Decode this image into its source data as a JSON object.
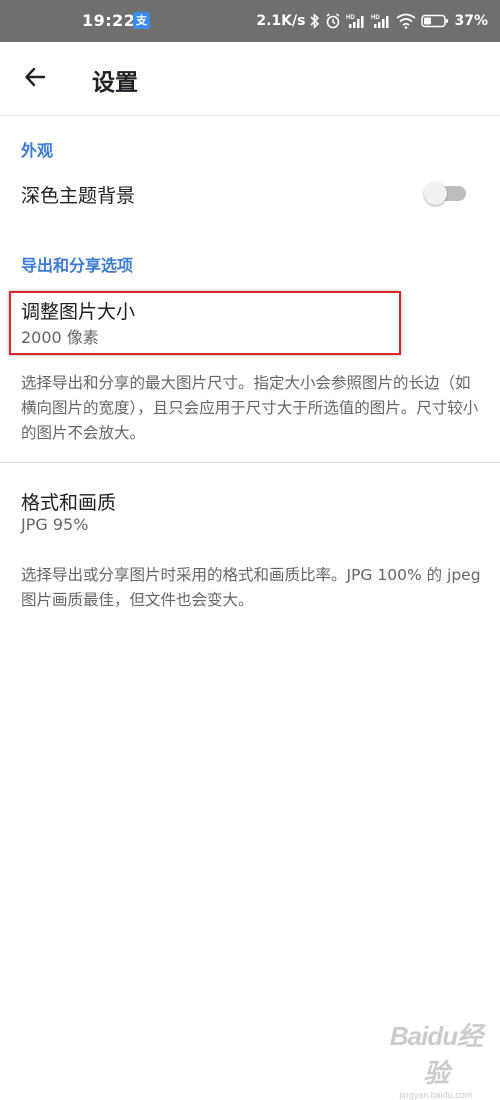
{
  "status_bar": {
    "time": "19:22",
    "app_icon_glyph": "支",
    "network_speed": "2.1K/s",
    "battery_percent": "37%",
    "icons": [
      "bluetooth-icon",
      "alarm-icon",
      "hd-signal-icon",
      "hd-signal-icon",
      "wifi-icon",
      "battery-icon"
    ]
  },
  "app_bar": {
    "title": "设置",
    "back_icon": "arrow-left-icon"
  },
  "sections": {
    "appearance": {
      "header": "外观",
      "dark_theme": {
        "title": "深色主题背景",
        "enabled": false
      }
    },
    "export_share": {
      "header": "导出和分享选项",
      "resize": {
        "title": "调整图片大小",
        "value": "2000 像素",
        "description": "选择导出和分享的最大图片尺寸。指定大小会参照图片的长边（如横向图片的宽度），且只会应用于尺寸大于所选值的图片。尺寸较小的图片不会放大。"
      },
      "format_quality": {
        "title": "格式和画质",
        "value": "JPG 95%",
        "description": "选择导出或分享图片时采用的格式和画质比率。JPG 100% 的 jpeg 图片画质最佳，但文件也会变大。"
      }
    }
  },
  "colors": {
    "accent": "#3a7bd5",
    "highlight": "#d8272b",
    "status_bar": "#6f6f6f"
  },
  "watermark": {
    "logo_text": "Baidu经验",
    "url": "jingyan.baidu.com"
  }
}
